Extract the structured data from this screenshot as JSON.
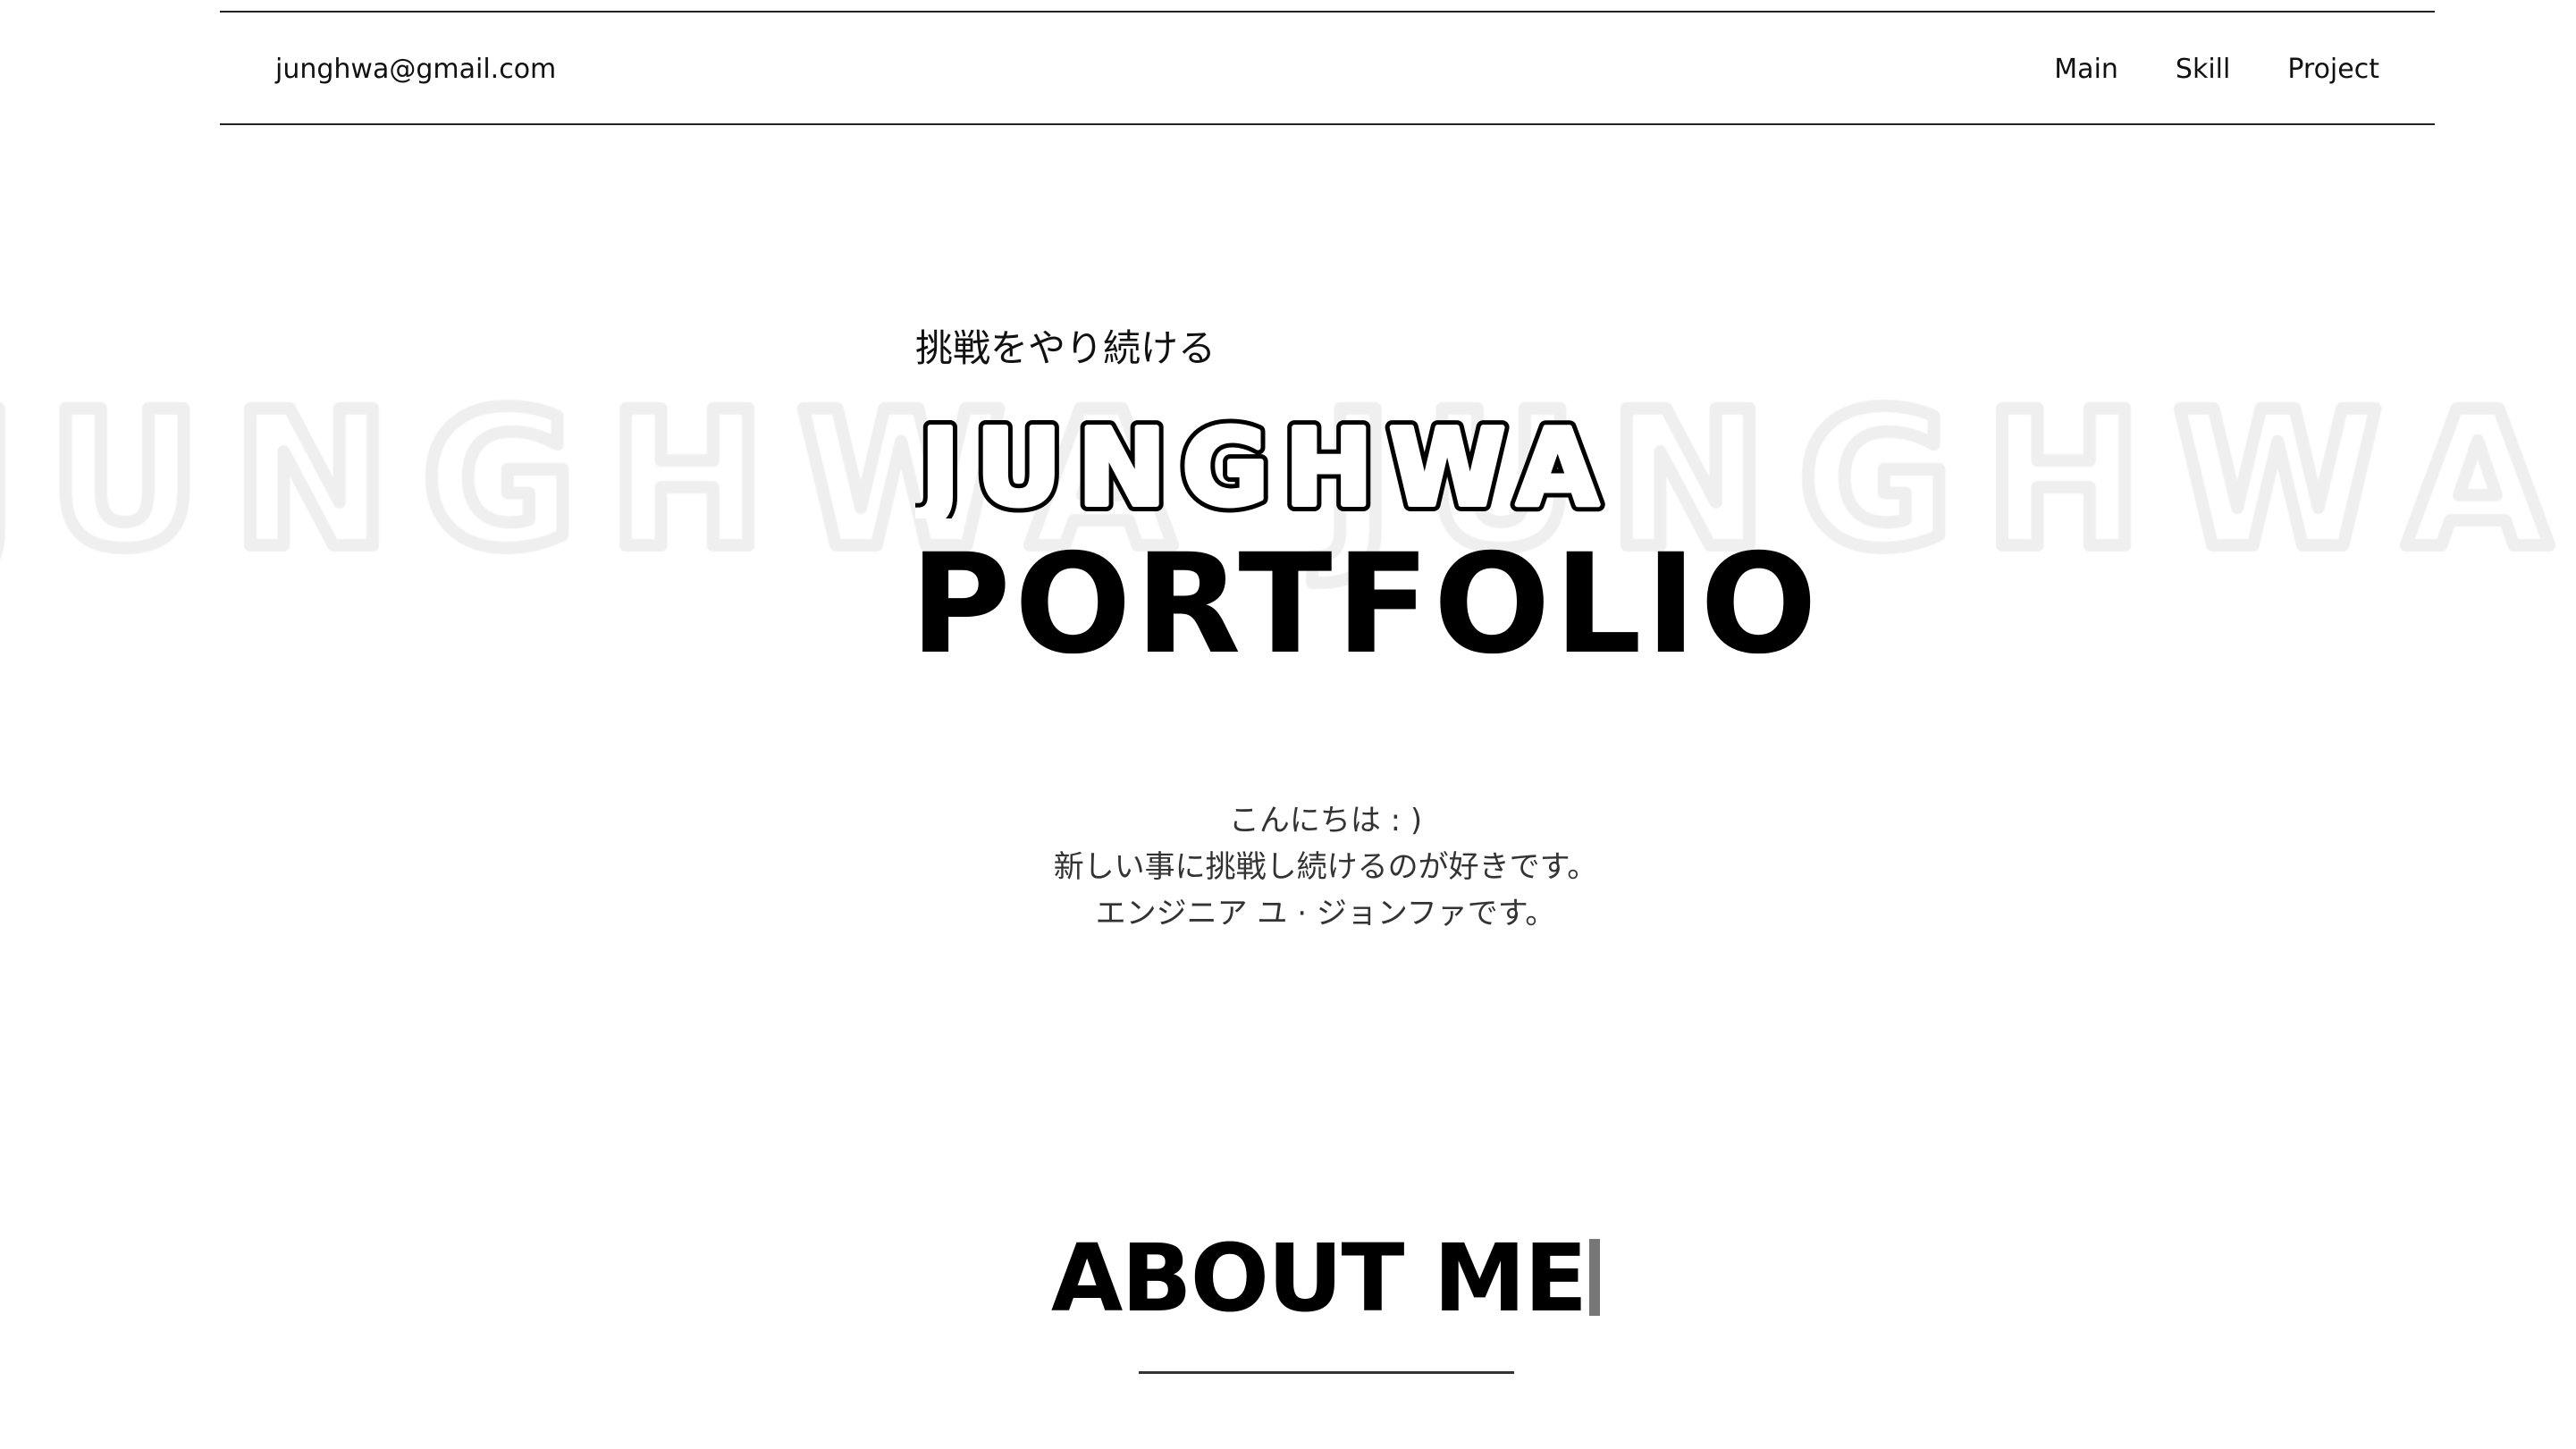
{
  "header": {
    "email": "junghwa@gmail.com",
    "nav": [
      {
        "label": "Main"
      },
      {
        "label": "Skill"
      },
      {
        "label": "Project"
      }
    ]
  },
  "hero": {
    "subtitle": "挑戦をやり続ける",
    "name_logo": "JUNGHWA",
    "title": "PORTFOLIO",
    "watermark_text": "JUNGHWA"
  },
  "intro": {
    "lines": [
      "こんにちは : )",
      "新しい事に挑戦し続けるのが好きです。",
      "エンジニア ユ · ジョンファです。"
    ]
  },
  "about": {
    "heading": "ABOUT ME"
  },
  "colors": {
    "text": "#000000",
    "background": "#ffffff",
    "watermark": "#f1f1f1",
    "caret": "#777777"
  }
}
